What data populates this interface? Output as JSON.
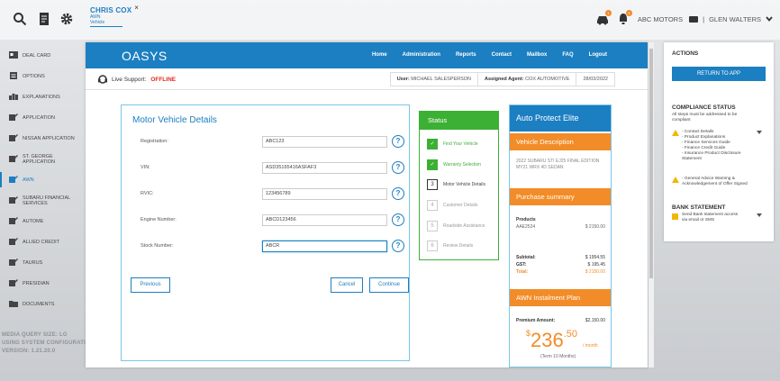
{
  "topbar": {
    "customer_name": "CHRIS COX",
    "customer_close": "×",
    "customer_sub1": "AWN",
    "customer_sub2": "Vehicle",
    "dealer": "ABC MOTORS",
    "user": "GLEN WALTERS",
    "divider": "|",
    "notif_count_1": "1",
    "notif_count_2": "4"
  },
  "sidebar": {
    "items": [
      {
        "label": "DEAL CARD"
      },
      {
        "label": "OPTIONS"
      },
      {
        "label": "EXPLANATIONS"
      },
      {
        "label": "APPLICATION"
      },
      {
        "label": "NISSAN APPLICATION"
      },
      {
        "label": "ST. GEORGE APPLICATION"
      },
      {
        "label": "AWN"
      },
      {
        "label": "SUBARU FINANCIAL SERVICES"
      },
      {
        "label": "AUTOME"
      },
      {
        "label": "ALLIED CREDIT"
      },
      {
        "label": "TAURUS"
      },
      {
        "label": "PRESIDIAN"
      },
      {
        "label": "DOCUMENTS"
      }
    ],
    "footer": [
      "MEDIA QUERY SIZE: LG",
      "USING SYSTEM CONFIGURATI",
      "VERSION: 1.21.20.0"
    ]
  },
  "oasys": {
    "logo": "OASYS",
    "nav": [
      "Home",
      "Administration",
      "Reports",
      "Contact",
      "Mailbox",
      "FAQ",
      "Logout"
    ],
    "live_support_label": "Live Support:",
    "live_support_status": "OFFLINE",
    "user_label": "User:",
    "user_value": "MICHAEL SALESPERSON",
    "agent_label": "Assigned Agent:",
    "agent_value": "COX AUTOMOTIVE",
    "date": "28/03/2022"
  },
  "form": {
    "title": "Motor Vehicle Details",
    "fields": [
      {
        "label": "Registration:",
        "value": "ABC123"
      },
      {
        "label": "VIN:",
        "value": "ASD35165416ASFAF3"
      },
      {
        "label": "RVIC:",
        "value": "123456789"
      },
      {
        "label": "Engine Number:",
        "value": "ABCD123456"
      },
      {
        "label": "Stock Number:",
        "value": "ABCR"
      }
    ],
    "help_glyph": "?",
    "previous": "Previous",
    "cancel": "Cancel",
    "continue": "Continue"
  },
  "status": {
    "title": "Status",
    "steps": [
      {
        "label": "Find Your Vehicle",
        "marker": "✓",
        "state": "done"
      },
      {
        "label": "Warranty Selection",
        "marker": "✓",
        "state": "done"
      },
      {
        "label": "Motor Vehicle Details",
        "marker": "3",
        "state": "current"
      },
      {
        "label": "Customer Details",
        "marker": "4",
        "state": "todo"
      },
      {
        "label": "Roadside Assistance",
        "marker": "5",
        "state": "todo"
      },
      {
        "label": "Review Details",
        "marker": "6",
        "state": "todo"
      }
    ]
  },
  "summary": {
    "title": "Auto Protect Elite",
    "vehicle_header": "Vehicle Description",
    "vehicle_line1": "2022 SUBARU STI EJ25 FINAL EDITION",
    "vehicle_line2": "MY21 WRX 4D SEDAN",
    "purchase_header": "Purchase summary",
    "products_label": "Products",
    "product_code": "AAE2524",
    "product_price": "$ 2150.00",
    "subtotal_label": "Subtotal:",
    "subtotal_value": "$ 1954.55",
    "gst_label": "GST:",
    "gst_value": "$ 195.45",
    "total_label": "Total:",
    "total_value": "$ 2150.00",
    "plan_header": "AWN Instalment Plan",
    "premium_label": "Premium Amount:",
    "premium_value": "$2,150.00",
    "monthly_dollar": "$",
    "monthly_whole": "236",
    "monthly_cents": ".50",
    "monthly_unit": "/ month",
    "term": "(Term 10 Months)"
  },
  "actions": {
    "title": "ACTIONS",
    "return_button": "RETURN TO APP",
    "compliance_title": "COMPLIANCE STATUS",
    "compliance_note1": "All steps must be addressed to be",
    "compliance_note2": "compliant",
    "c1_lines": [
      "- Contact Details",
      "- Product Explanations",
      "- Finance Services Guide",
      "- Finance Credit Guide",
      "- Insurance Product Disclosure",
      "Statement"
    ],
    "c2_lines": [
      "- General Advice Warning &",
      "Acknowledgement of Offer Signed"
    ],
    "bank_title": "BANK STATEMENT",
    "bank_lines": [
      "Send Bank statement access",
      "via email or SMS"
    ]
  },
  "colors": {
    "primary": "#1c7fc1",
    "orange": "#f28c28",
    "green": "#3cb034",
    "offline": "#e02a1f"
  }
}
